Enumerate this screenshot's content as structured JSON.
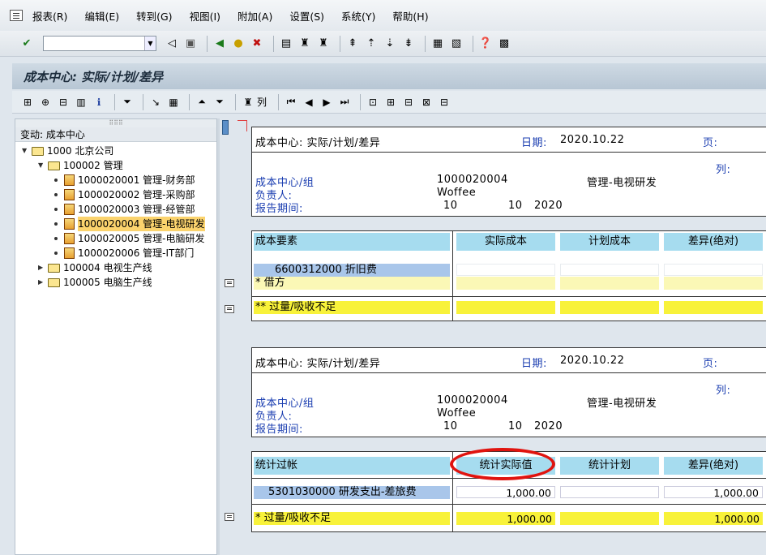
{
  "menu": {
    "items": [
      "报表(R)",
      "编辑(E)",
      "转到(G)",
      "视图(I)",
      "附加(A)",
      "设置(S)",
      "系统(Y)",
      "帮助(H)"
    ]
  },
  "stdbar": {
    "command_value": ""
  },
  "title": "成本中心: 实际/计划/差异",
  "appbar": {
    "columns_label": "列"
  },
  "tree": {
    "header": "变动:  成本中心",
    "root": "1000 北京公司",
    "group": "100002 管理",
    "items": [
      "1000020001 管理-财务部",
      "1000020002 管理-采购部",
      "1000020003 管理-经管部",
      "1000020004 管理-电视研发",
      "1000020005 管理-电脑研发",
      "1000020006 管理-IT部门"
    ],
    "other_groups": [
      "100004 电视生产线",
      "100005 电脑生产线"
    ]
  },
  "report1": {
    "title": "成本中心: 实际/计划/差异",
    "date_label": "日期:",
    "date": "2020.10.22",
    "page_label": "页:",
    "column_label": "列:",
    "cc_label": "成本中心/组",
    "cc_value": "1000020004",
    "cc_name": "管理-电视研发",
    "owner_label": "负责人:",
    "owner": "Woffee",
    "period_label": "报告期间:",
    "period_from": "10",
    "period_to": "10",
    "year": "2020",
    "headers": [
      "成本要素",
      "实际成本",
      "计划成本",
      "差异(绝对)"
    ],
    "element": "6600312000  折旧费",
    "debit": "*  借方",
    "total": "** 过量/吸收不足"
  },
  "report2": {
    "title": "成本中心: 实际/计划/差异",
    "date_label": "日期:",
    "date": "2020.10.22",
    "page_label": "页:",
    "column_label": "列:",
    "cc_label": "成本中心/组",
    "cc_value": "1000020004",
    "cc_name": "管理-电视研发",
    "owner_label": "负责人:",
    "owner": "Woffee",
    "period_label": "报告期间:",
    "period_from": "10",
    "period_to": "10",
    "year": "2020",
    "headers": [
      "统计过帐",
      "统计实际值",
      "统计计划",
      "差异(绝对)"
    ],
    "element": "5301030000  研发支出-差旅费",
    "actual": "1,000.00",
    "variance": "1,000.00",
    "total": "* 过量/吸收不足",
    "total_actual": "1,000.00",
    "total_variance": "1,000.00"
  },
  "colors": {
    "header_cell": "#a6dcef",
    "total_row": "#f8f23a",
    "highlight": "#e0140f",
    "selected_node": "#fbd36d"
  }
}
